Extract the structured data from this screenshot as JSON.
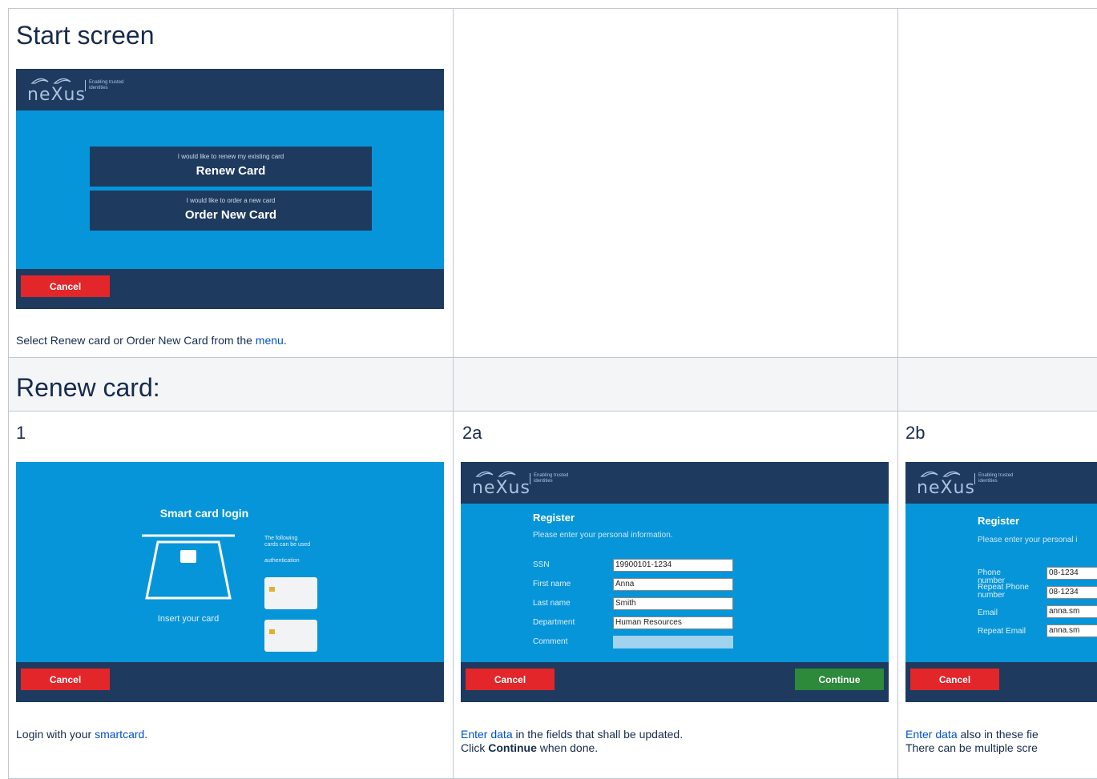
{
  "start_section": {
    "title": "Start screen",
    "caption_before": "Select Renew card or Order New Card from the ",
    "caption_link": "menu",
    "caption_after": "."
  },
  "renew_section": {
    "title": "Renew card:"
  },
  "kiosk": {
    "logo_word": "neXus",
    "logo_tag": "Enabling trusted identities",
    "cancel_label": "Cancel",
    "continue_label": "Continue"
  },
  "start_screen": {
    "options": [
      {
        "subtitle": "I would like to renew my existing card",
        "label": "Renew Card"
      },
      {
        "subtitle": "I would like to order a new card",
        "label": "Order New Card"
      }
    ]
  },
  "steps": [
    {
      "number": "1",
      "screen_title": "Smart card login",
      "insert_text": "Insert your card",
      "side_note": "The following cards can be used",
      "side_note2": "authentication",
      "caption_before": "Login with your ",
      "caption_link": "smartcard",
      "caption_after": "."
    },
    {
      "number": "2a",
      "form_title": "Register",
      "form_subtitle": "Please enter your personal information.",
      "fields": [
        {
          "label": "SSN",
          "value": "19900101-1234"
        },
        {
          "label": "First name",
          "value": "Anna"
        },
        {
          "label": "Last name",
          "value": "Smith"
        },
        {
          "label": "Department",
          "value": "Human Resources"
        },
        {
          "label": "Comment",
          "value": ""
        }
      ],
      "caption_link": "Enter data",
      "caption_after": " in the fields that shall be updated.",
      "caption_line2_before": "Click ",
      "caption_line2_bold": "Continue",
      "caption_line2_after": " when done."
    },
    {
      "number": "2b",
      "form_title": "Register",
      "form_subtitle": "Please enter your personal i",
      "fields": [
        {
          "label": "Phone number",
          "value": "08-1234"
        },
        {
          "label": "Repeat Phone number",
          "value": "08-1234"
        },
        {
          "label": "Email",
          "value": "anna.sm"
        },
        {
          "label": "Repeat Email",
          "value": "anna.sm"
        }
      ],
      "caption_link": "Enter data",
      "caption_after": " also in these fie",
      "caption_line2": "There can be multiple scre"
    }
  ]
}
